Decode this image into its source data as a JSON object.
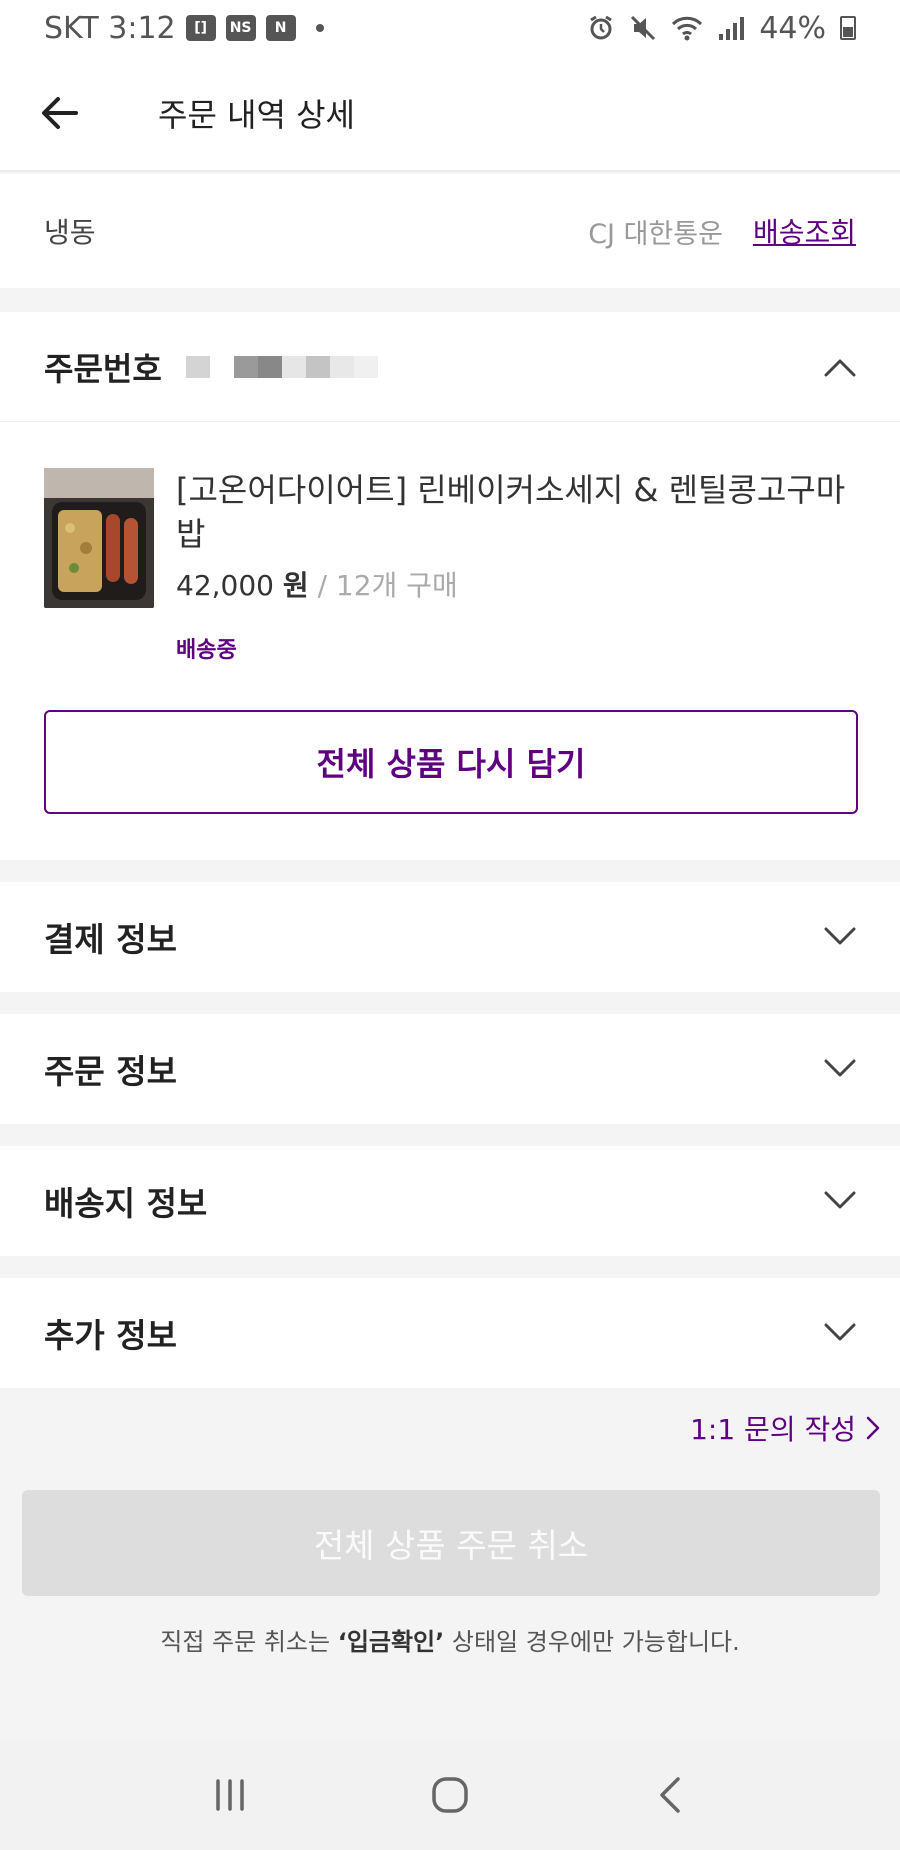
{
  "status_bar": {
    "carrier_time": "SKT 3:12",
    "badges": [
      "[]",
      "NS",
      "N"
    ],
    "battery": "44%",
    "icons": [
      "alarm-icon",
      "mute-icon",
      "wifi-icon",
      "signal-icon",
      "battery-icon"
    ]
  },
  "header": {
    "title": "주문 내역 상세",
    "back_icon": "arrow-left-icon"
  },
  "delivery": {
    "type": "냉동",
    "courier": "CJ 대한통운",
    "track_label": "배송조회"
  },
  "order": {
    "label": "주문번호",
    "number_redacted": true,
    "product": {
      "name": "[고온어다이어트] 린베이커소세지 & 렌틸콩고구마밥",
      "price": "42,000",
      "currency": "원",
      "quantity_text": "/ 12개 구매",
      "status": "배송중"
    },
    "reorder_label": "전체 상품 다시 담기"
  },
  "sections": [
    {
      "label": "결제 정보"
    },
    {
      "label": "주문 정보"
    },
    {
      "label": "배송지 정보"
    },
    {
      "label": "추가 정보"
    }
  ],
  "inquiry_label": "1:1 문의 작성",
  "cancel": {
    "button_label": "전체 상품 주문 취소",
    "note_prefix": "직접 주문 취소는 ",
    "note_bold": "‘입금확인’",
    "note_suffix": " 상태일 경우에만 가능합니다."
  },
  "colors": {
    "accent": "#5f0080",
    "disabled": "#dddddd"
  }
}
